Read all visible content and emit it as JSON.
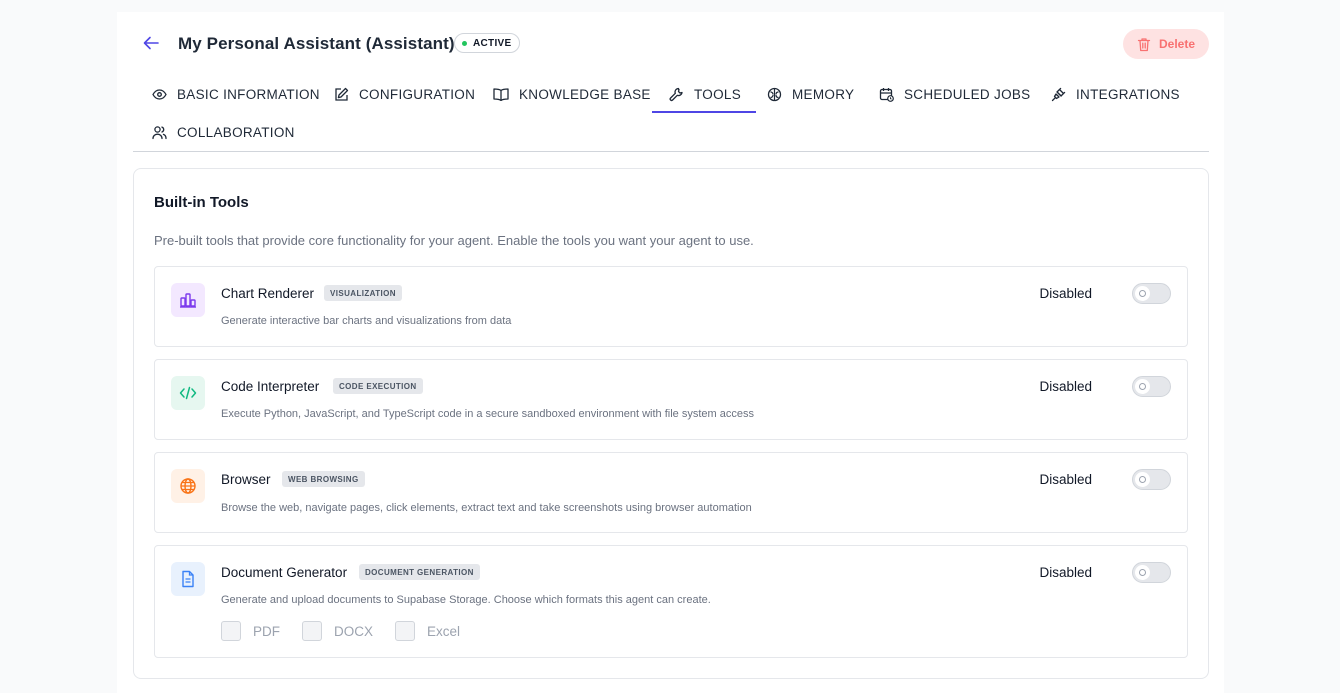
{
  "header": {
    "title": "My Personal Assistant (Assistant)",
    "status": "ACTIVE",
    "delete_label": "Delete"
  },
  "tabs": [
    {
      "label": "BASIC INFORMATION",
      "icon": "eye-icon"
    },
    {
      "label": "CONFIGURATION",
      "icon": "edit-icon"
    },
    {
      "label": "KNOWLEDGE BASE",
      "icon": "book-icon"
    },
    {
      "label": "TOOLS",
      "icon": "wrench-icon",
      "active": true
    },
    {
      "label": "MEMORY",
      "icon": "brain-icon"
    },
    {
      "label": "SCHEDULED JOBS",
      "icon": "calendar-icon"
    },
    {
      "label": "INTEGRATIONS",
      "icon": "plug-icon"
    },
    {
      "label": "COLLABORATION",
      "icon": "users-icon"
    }
  ],
  "builtin": {
    "title": "Built-in Tools",
    "description": "Pre-built tools that provide core functionality for your agent. Enable the tools you want your agent to use.",
    "tools": [
      {
        "name": "Chart Renderer",
        "tag": "VISUALIZATION",
        "description": "Generate interactive bar charts and visualizations from data",
        "status": "Disabled",
        "icon": "bar-chart-icon",
        "icon_color": "#7c3aed",
        "icon_bg": "#f3e8ff"
      },
      {
        "name": "Code Interpreter",
        "tag": "CODE EXECUTION",
        "description": "Execute Python, JavaScript, and TypeScript code in a secure sandboxed environment with file system access",
        "status": "Disabled",
        "icon": "code-icon",
        "icon_color": "#10b981",
        "icon_bg": "#e6f7f0"
      },
      {
        "name": "Browser",
        "tag": "WEB BROWSING",
        "description": "Browse the web, navigate pages, click elements, extract text and take screenshots using browser automation",
        "status": "Disabled",
        "icon": "globe-icon",
        "icon_color": "#f97316",
        "icon_bg": "#fff1e6"
      },
      {
        "name": "Document Generator",
        "tag": "DOCUMENT GENERATION",
        "description": "Generate and upload documents to Supabase Storage. Choose which formats this agent can create.",
        "status": "Disabled",
        "icon": "document-icon",
        "icon_color": "#3b82f6",
        "icon_bg": "#e8f1fd",
        "formats": [
          "PDF",
          "DOCX",
          "Excel"
        ]
      }
    ]
  }
}
